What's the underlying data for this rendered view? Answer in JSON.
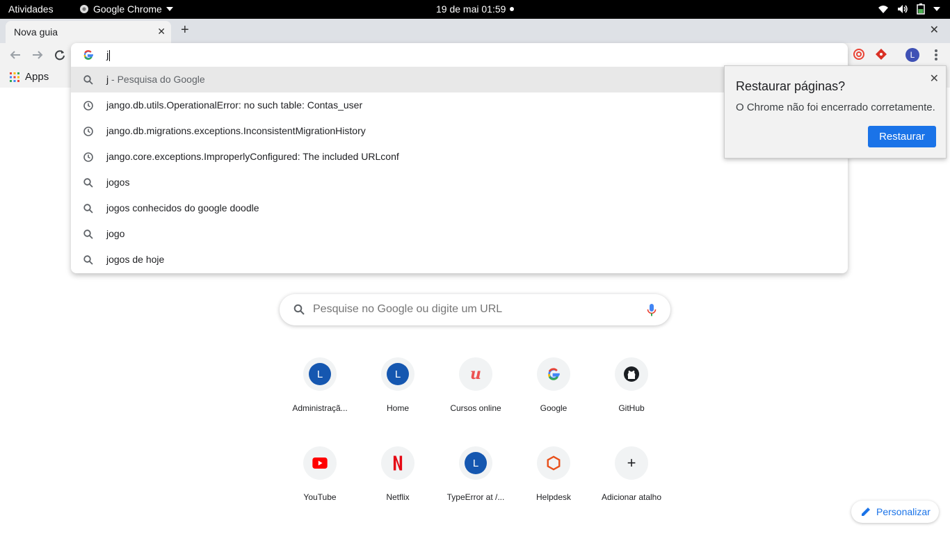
{
  "system_bar": {
    "activities": "Atividades",
    "app_name": "Google Chrome",
    "clock": "19 de mai  01:59"
  },
  "tab": {
    "title": "Nova guia"
  },
  "omnibox": {
    "value": "j",
    "suggestions": [
      {
        "type": "search",
        "text": "j",
        "suffix": " - Pesquisa do Google",
        "selected": true
      },
      {
        "type": "history",
        "text": "jango.db.utils.OperationalError: no such table: Contas_user"
      },
      {
        "type": "history",
        "text": "jango.db.migrations.exceptions.InconsistentMigrationHistory"
      },
      {
        "type": "history",
        "text": "jango.core.exceptions.ImproperlyConfigured: The included URLconf"
      },
      {
        "type": "search",
        "text": "jogos"
      },
      {
        "type": "search",
        "text": "jogos conhecidos do google doodle"
      },
      {
        "type": "search",
        "text": "jogo"
      },
      {
        "type": "search",
        "text": "jogos de hoje"
      }
    ]
  },
  "profile": {
    "initial": "L",
    "color": "#3f51b5"
  },
  "bookmarks": {
    "apps_label": "Apps"
  },
  "restore_dialog": {
    "title": "Restaurar páginas?",
    "message": "O Chrome não foi encerrado corretamente.",
    "button": "Restaurar"
  },
  "ntp": {
    "search_placeholder": "Pesquise no Google ou digite um URL",
    "shortcuts": [
      {
        "label": "Administraçã...",
        "icon": "letter",
        "letter": "L"
      },
      {
        "label": "Home",
        "icon": "letter",
        "letter": "L"
      },
      {
        "label": "Cursos online",
        "icon": "udemy"
      },
      {
        "label": "Google",
        "icon": "google"
      },
      {
        "label": "GitHub",
        "icon": "github"
      },
      {
        "label": "YouTube",
        "icon": "youtube"
      },
      {
        "label": "Netflix",
        "icon": "netflix"
      },
      {
        "label": "TypeError at /...",
        "icon": "letter",
        "letter": "L"
      },
      {
        "label": "Helpdesk",
        "icon": "helpdesk"
      },
      {
        "label": "Adicionar atalho",
        "icon": "add"
      }
    ],
    "customize_label": "Personalizar"
  },
  "colors": {
    "accent": "#1a73e8",
    "letter_avatar": "#1557b0"
  }
}
